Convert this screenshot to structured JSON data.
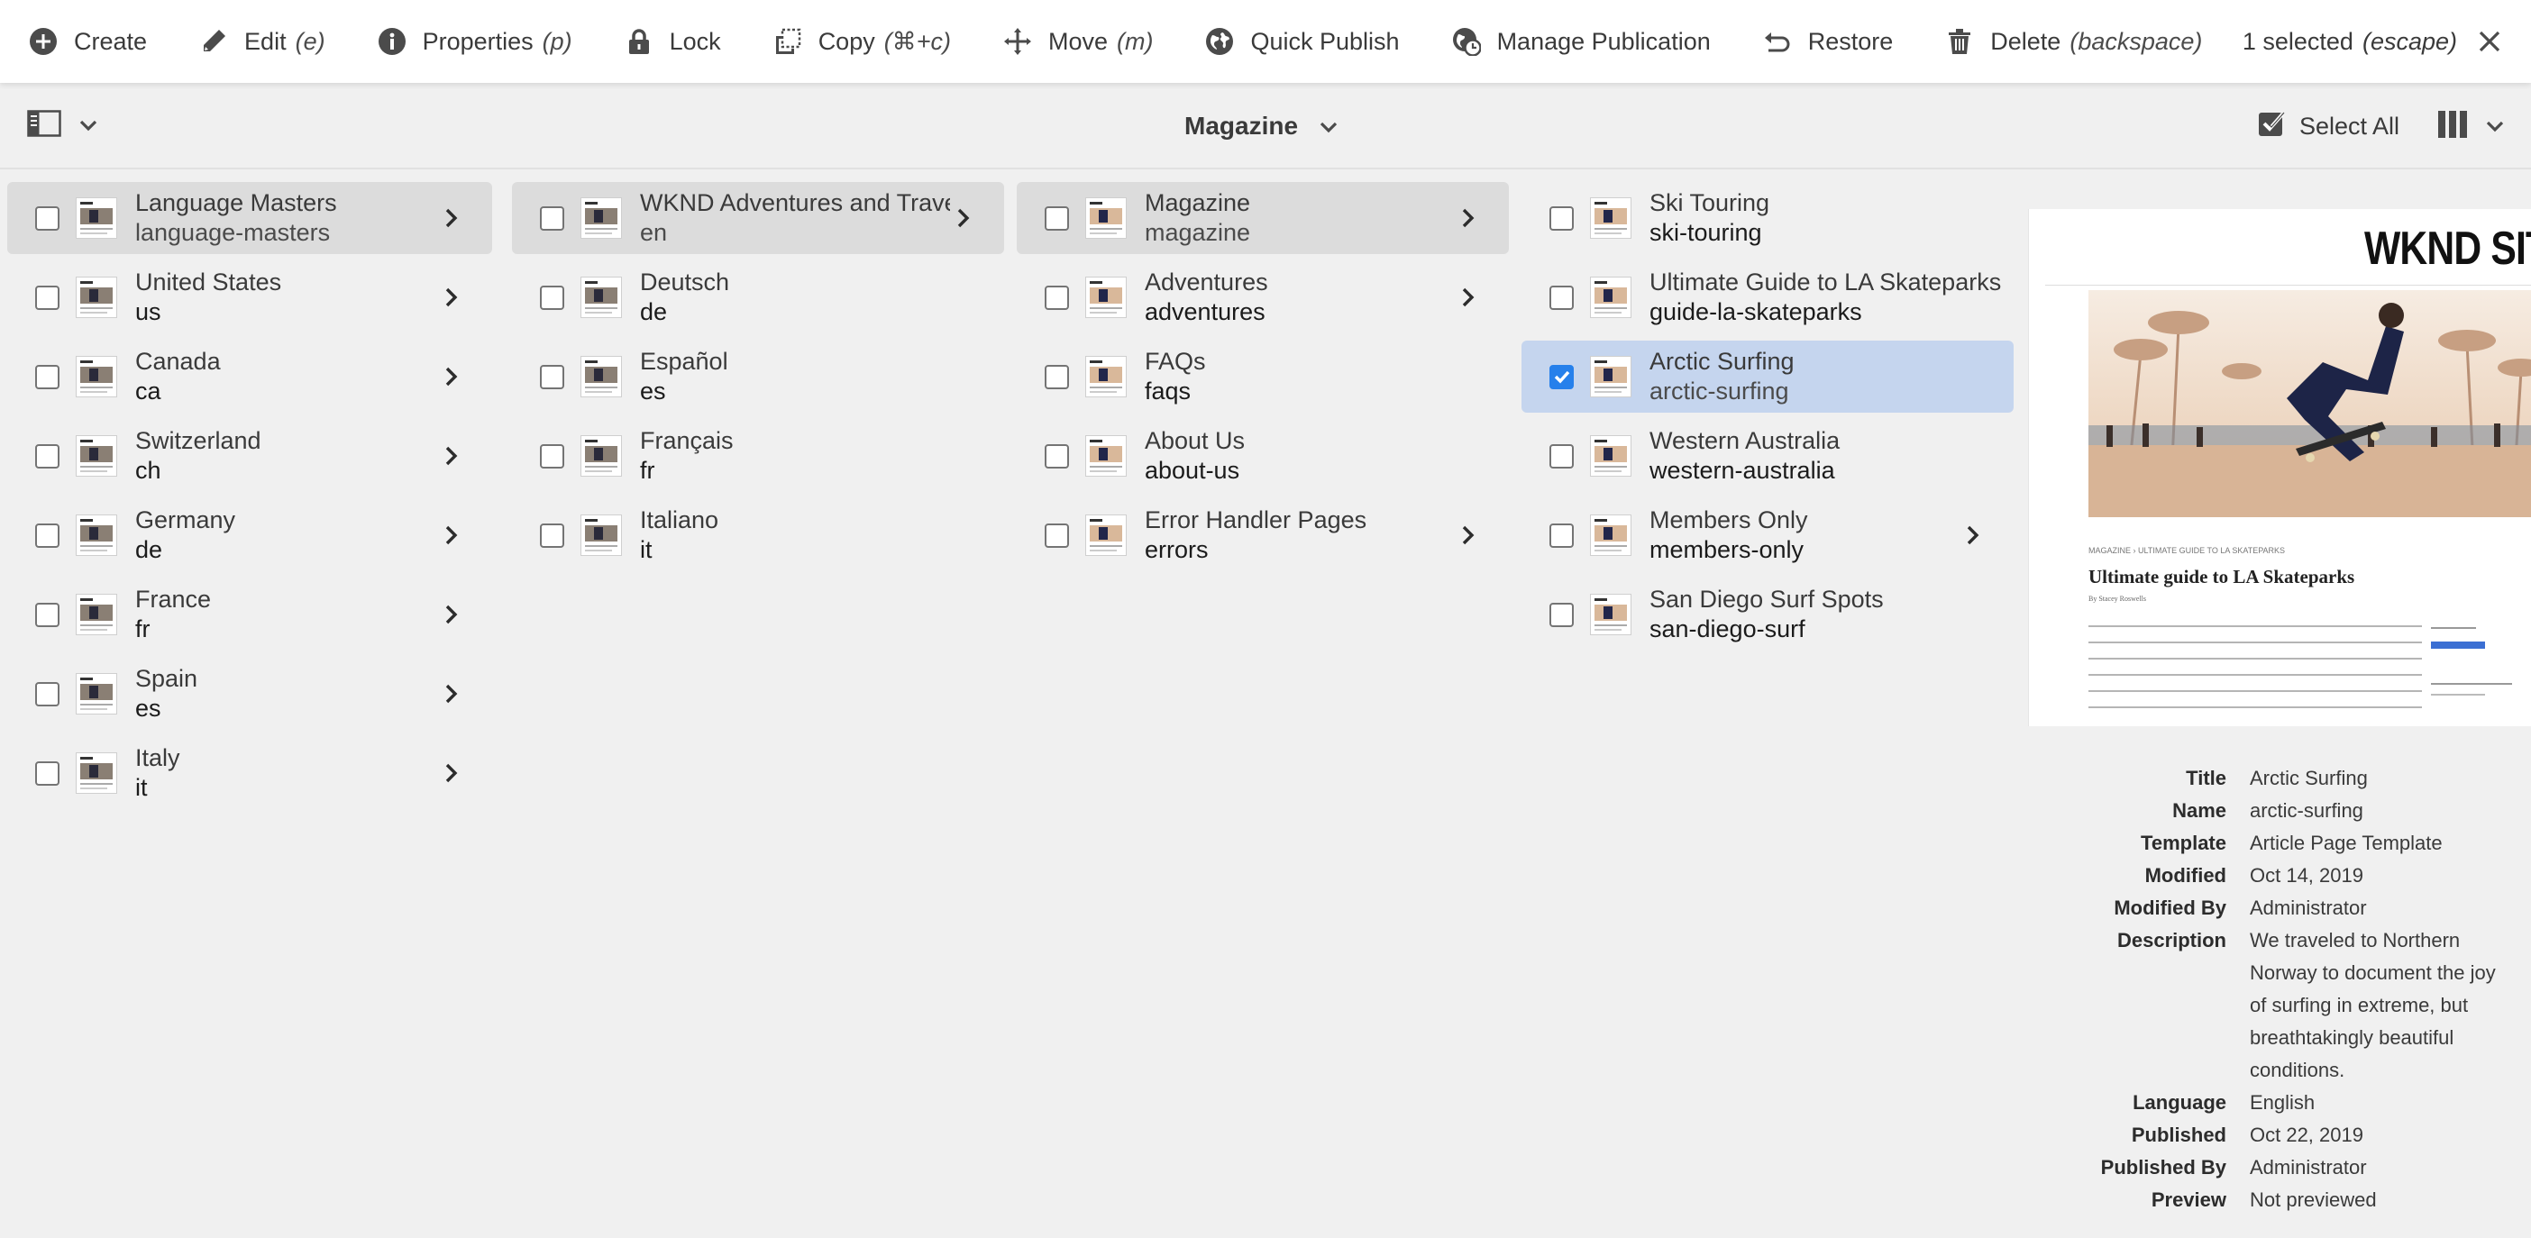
{
  "actionbar": {
    "actions": [
      {
        "label": "Create",
        "shortcut": "",
        "icon": "add-circle-icon"
      },
      {
        "label": "Edit",
        "shortcut": "(e)",
        "icon": "pencil-icon"
      },
      {
        "label": "Properties",
        "shortcut": "(p)",
        "icon": "info-icon"
      },
      {
        "label": "Lock",
        "shortcut": "",
        "icon": "lock-icon"
      },
      {
        "label": "Copy",
        "shortcut": "(⌘+c)",
        "icon": "copy-icon"
      },
      {
        "label": "Move",
        "shortcut": "(m)",
        "icon": "move-icon"
      },
      {
        "label": "Quick Publish",
        "shortcut": "",
        "icon": "globe-icon"
      },
      {
        "label": "Manage Publication",
        "shortcut": "",
        "icon": "globe-clock-icon"
      },
      {
        "label": "Restore",
        "shortcut": "",
        "icon": "restore-icon"
      },
      {
        "label": "Delete",
        "shortcut": "(backspace)",
        "icon": "trash-icon"
      }
    ],
    "selection": {
      "text": "1 selected",
      "shortcut": "(escape)"
    }
  },
  "toolbar": {
    "breadcrumb": "Magazine",
    "select_all": "Select All"
  },
  "columns": [
    {
      "items": [
        {
          "title": "Language Masters",
          "name": "language-masters",
          "has_children": true,
          "state": "active"
        },
        {
          "title": "United States",
          "name": "us",
          "has_children": true,
          "state": ""
        },
        {
          "title": "Canada",
          "name": "ca",
          "has_children": true,
          "state": ""
        },
        {
          "title": "Switzerland",
          "name": "ch",
          "has_children": true,
          "state": ""
        },
        {
          "title": "Germany",
          "name": "de",
          "has_children": true,
          "state": ""
        },
        {
          "title": "France",
          "name": "fr",
          "has_children": true,
          "state": ""
        },
        {
          "title": "Spain",
          "name": "es",
          "has_children": true,
          "state": ""
        },
        {
          "title": "Italy",
          "name": "it",
          "has_children": true,
          "state": ""
        }
      ]
    },
    {
      "items": [
        {
          "title": "WKND Adventures and Travel",
          "name": "en",
          "has_children": true,
          "state": "active"
        },
        {
          "title": "Deutsch",
          "name": "de",
          "has_children": false,
          "state": ""
        },
        {
          "title": "Español",
          "name": "es",
          "has_children": false,
          "state": ""
        },
        {
          "title": "Français",
          "name": "fr",
          "has_children": false,
          "state": ""
        },
        {
          "title": "Italiano",
          "name": "it",
          "has_children": false,
          "state": ""
        }
      ]
    },
    {
      "items": [
        {
          "title": "Magazine",
          "name": "magazine",
          "has_children": true,
          "state": "active"
        },
        {
          "title": "Adventures",
          "name": "adventures",
          "has_children": true,
          "state": ""
        },
        {
          "title": "FAQs",
          "name": "faqs",
          "has_children": false,
          "state": ""
        },
        {
          "title": "About Us",
          "name": "about-us",
          "has_children": false,
          "state": ""
        },
        {
          "title": "Error Handler Pages",
          "name": "errors",
          "has_children": true,
          "state": ""
        }
      ]
    },
    {
      "items": [
        {
          "title": "Ski Touring",
          "name": "ski-touring",
          "has_children": false,
          "state": ""
        },
        {
          "title": "Ultimate Guide to LA Skateparks",
          "name": "guide-la-skateparks",
          "has_children": false,
          "state": ""
        },
        {
          "title": "Arctic Surfing",
          "name": "arctic-surfing",
          "has_children": false,
          "state": "selected"
        },
        {
          "title": "Western Australia",
          "name": "western-australia",
          "has_children": false,
          "state": ""
        },
        {
          "title": "Members Only",
          "name": "members-only",
          "has_children": true,
          "state": ""
        },
        {
          "title": "San Diego Surf Spots",
          "name": "san-diego-surf",
          "has_children": false,
          "state": ""
        }
      ]
    }
  ],
  "preview": {
    "logo": "WKND SIT",
    "breadcrumb": "MAGAZINE  ›  ULTIMATE GUIDE TO LA SKATEPARKS",
    "article_title": "Ultimate guide to LA Skateparks",
    "byline": "By Stacey Roswells"
  },
  "metadata": [
    {
      "key": "Title",
      "value": "Arctic Surfing"
    },
    {
      "key": "Name",
      "value": "arctic-surfing"
    },
    {
      "key": "Template",
      "value": "Article Page Template"
    },
    {
      "key": "Modified",
      "value": "Oct 14, 2019"
    },
    {
      "key": "Modified By",
      "value": "Administrator"
    },
    {
      "key": "Description",
      "value": "We traveled to Northern Norway to document the joy of surfing in extreme, but breathtakingly beautiful conditions."
    },
    {
      "key": "Language",
      "value": "English"
    },
    {
      "key": "Published",
      "value": "Oct 22, 2019"
    },
    {
      "key": "Published By",
      "value": "Administrator"
    },
    {
      "key": "Preview",
      "value": "Not previewed"
    }
  ],
  "colors": {
    "background": "#f0f0f0",
    "actionbar": "#ffffff",
    "active_row": "#dcdcdc",
    "selected_row": "#c5d5ee",
    "checkbox_checked": "#2680eb"
  }
}
